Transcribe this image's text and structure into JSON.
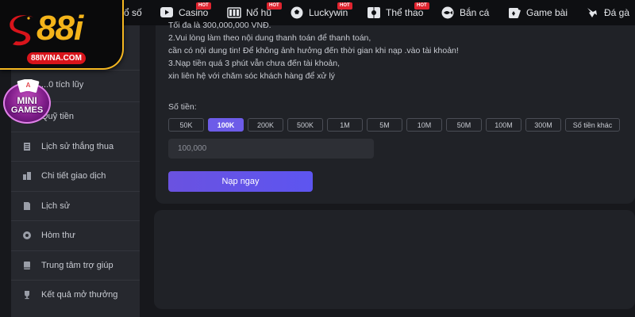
{
  "brand": {
    "logo_text": "88i",
    "domain": "88IVINA.COM",
    "colors": {
      "gold": "#f4b41a",
      "red": "#d8141b"
    }
  },
  "minigames": {
    "line1": "MINI",
    "line2": "GAMES"
  },
  "nav": {
    "items": [
      {
        "label": "Xổ số",
        "icon": "lottery-icon",
        "hot": false
      },
      {
        "label": "Casino",
        "icon": "tv-icon",
        "hot": true
      },
      {
        "label": "Nổ hũ",
        "icon": "slot-machine-icon",
        "hot": true
      },
      {
        "label": "Luckywin",
        "icon": "soccer-ball-icon",
        "hot": true
      },
      {
        "label": "Thể thao",
        "icon": "sports-icon",
        "hot": true
      },
      {
        "label": "Bắn cá",
        "icon": "fish-icon",
        "hot": false
      },
      {
        "label": "Game bài",
        "icon": "card-game-icon",
        "hot": false
      },
      {
        "label": "Đá gà",
        "icon": "rooster-icon",
        "hot": false
      }
    ],
    "hot_label": "HOT"
  },
  "sidebar": {
    "items": [
      {
        "label": "...0 tích lũy",
        "icon": "gift-icon"
      },
      {
        "label": "Quỹ tiền",
        "icon": "wallet-icon"
      },
      {
        "label": "Lịch sử thắng thua",
        "icon": "list-icon"
      },
      {
        "label": "Chi tiết giao dịch",
        "icon": "building-icon"
      },
      {
        "label": "Lịch sử",
        "icon": "document-icon"
      },
      {
        "label": "Hòm thư",
        "icon": "mail-icon"
      },
      {
        "label": "Trung tâm trợ giúp",
        "icon": "help-book-icon"
      },
      {
        "label": "Kết quả mở thưởng",
        "icon": "trophy-icon"
      }
    ]
  },
  "deposit": {
    "instructions": [
      "Tối đa là 300,000,000 VNĐ.",
      "2.Vui lòng làm theo nội dung thanh toán để thanh toán,",
      "cần có nội dung tin! Để không ảnh hưởng đến thời gian khi nạp .vào tài khoản!",
      "3.Nạp tiền quá 3 phút vẫn chưa đến tài khoản,",
      "xin liên hệ với chăm sóc khách hàng để xử lý"
    ],
    "amount_label": "Số tiền:",
    "amounts": [
      "50K",
      "100K",
      "200K",
      "500K",
      "1M",
      "5M",
      "10M",
      "50M",
      "100M",
      "300M",
      "Số tiền khác"
    ],
    "selected_amount": "100K",
    "input_value": "100,000",
    "submit_label": "Nạp ngay",
    "accent_color": "#6d5ce8"
  }
}
